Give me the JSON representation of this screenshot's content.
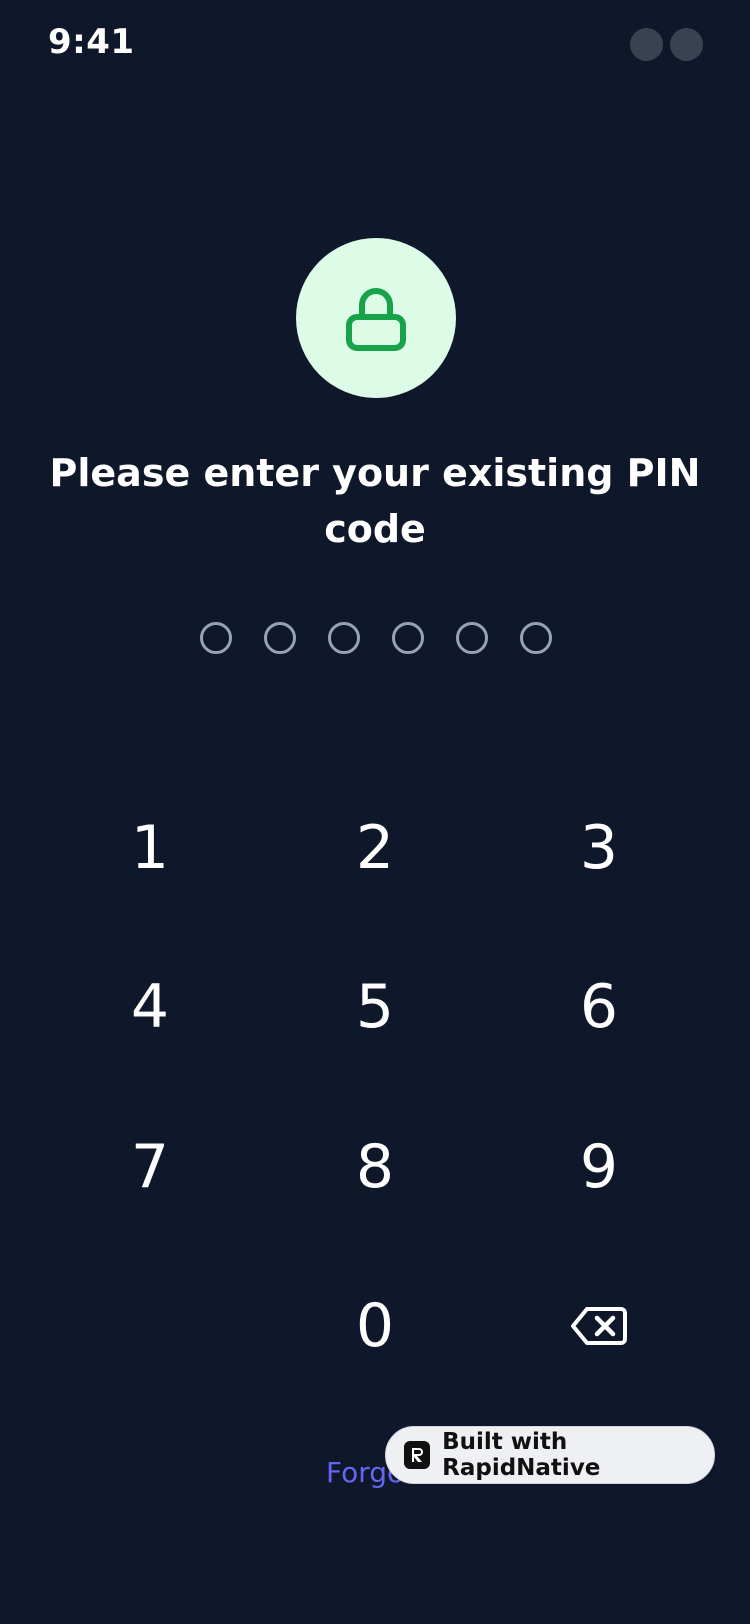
{
  "status_bar": {
    "time": "9:41"
  },
  "lock": {
    "icon": "lock-icon",
    "badge_color": "#dcfce7",
    "icon_color": "#16a34a"
  },
  "title": "Please enter your existing PIN code",
  "pin": {
    "length": 6,
    "entered": 0
  },
  "keypad": {
    "keys": [
      "1",
      "2",
      "3",
      "4",
      "5",
      "6",
      "7",
      "8",
      "9",
      "0"
    ],
    "backspace_icon": "backspace-icon"
  },
  "forgot_label": "Forgo",
  "badge": {
    "label": "Built with RapidNative",
    "icon": "rapidnative-logo-icon"
  },
  "colors": {
    "background": "#0f172a",
    "accent": "#6366f1",
    "pin_dot": "#94a3b8"
  }
}
